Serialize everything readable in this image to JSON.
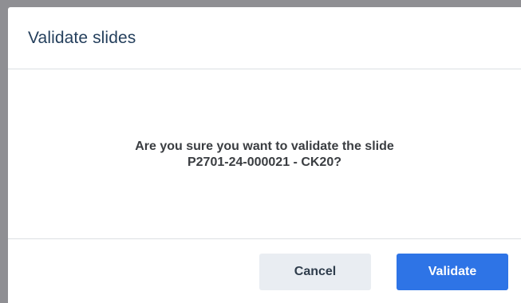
{
  "dialog": {
    "title": "Validate slides",
    "message_line1": "Are you sure you want to validate the slide",
    "message_line2": "P2701-24-000021 - CK20?",
    "cancel_label": "Cancel",
    "validate_label": "Validate"
  },
  "colors": {
    "primary": "#2e74e6",
    "secondary_bg": "#e9edf2",
    "title_text": "#243f5c",
    "body_text": "#3a3d41",
    "overlay": "#8f8f93"
  }
}
